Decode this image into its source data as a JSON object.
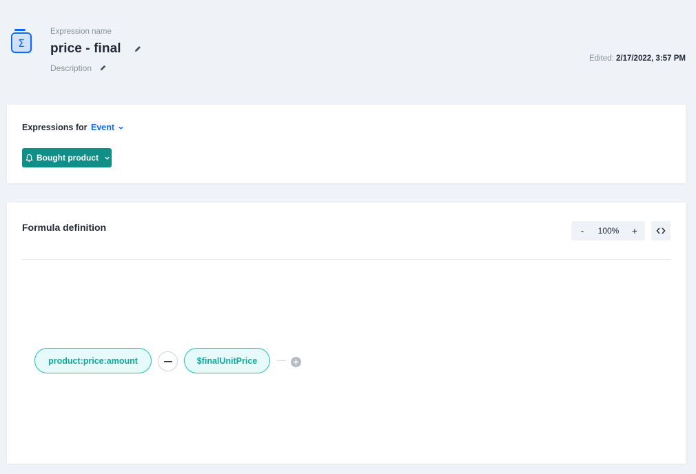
{
  "header": {
    "name_label": "Expression name",
    "title": "price - final",
    "description_label": "Description",
    "edited_prefix": "Edited:",
    "edited_value": "2/17/2022, 3:57 PM",
    "icon": "sigma-icon"
  },
  "expressions": {
    "for_label": "Expressions for",
    "type_value": "Event",
    "event_button": "Bought product"
  },
  "formula": {
    "title": "Formula definition",
    "zoom_minus": "-",
    "zoom_level": "100%",
    "zoom_plus": "+",
    "operand_left": "product:price:amount",
    "operator": "minus",
    "operand_right": "$finalUnitPrice"
  },
  "colors": {
    "accent_blue": "#0b68ff",
    "teal_button": "#0f8f88",
    "pill_border": "#18c2b4",
    "pill_text": "#0fa89c",
    "background": "#eff2f6"
  }
}
